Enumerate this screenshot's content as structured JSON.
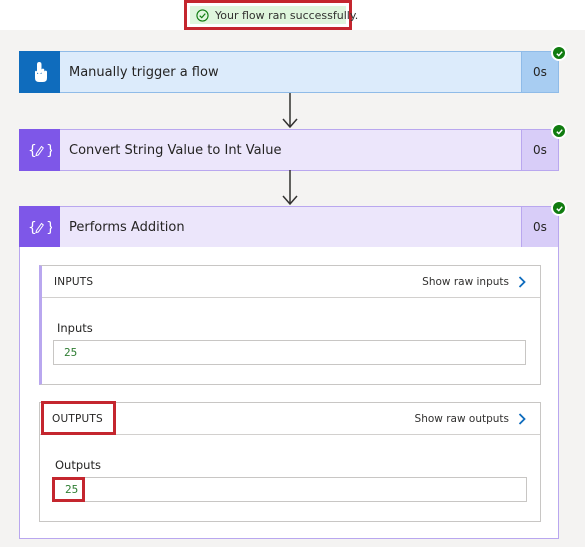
{
  "banner": {
    "message": "Your flow ran successfully."
  },
  "steps": [
    {
      "title": "Manually trigger a flow",
      "duration": "0s",
      "icon": "touch-icon"
    },
    {
      "title": "Convert String Value to Int Value",
      "duration": "0s",
      "icon": "compose-icon"
    },
    {
      "title": "Performs Addition",
      "duration": "0s",
      "icon": "compose-icon"
    }
  ],
  "inputs": {
    "header": "INPUTS",
    "raw_link": "Show raw inputs",
    "field_label": "Inputs",
    "value": "25"
  },
  "outputs": {
    "header": "OUTPUTS",
    "raw_link": "Show raw outputs",
    "field_label": "Outputs",
    "value": "25"
  },
  "colors": {
    "success": "#107c10",
    "trigger_accent": "#0f6cbd",
    "compose_accent": "#7e57e8",
    "highlight": "#c4262e"
  }
}
